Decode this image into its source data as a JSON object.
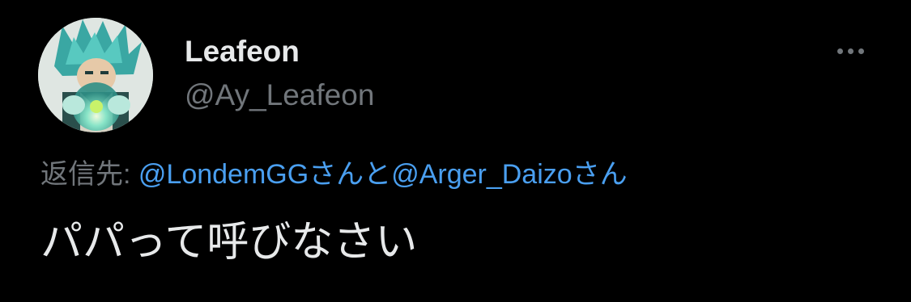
{
  "user": {
    "display_name": "Leafeon",
    "handle": "@Ay_Leafeon",
    "avatar_icon": "anime-character-avatar"
  },
  "reply": {
    "prefix": "返信先: ",
    "mentions": [
      {
        "name": "@LondemGG",
        "suffix": "さんと"
      },
      {
        "name": "@Arger_Daizo",
        "suffix": "さん"
      }
    ]
  },
  "tweet": {
    "text": "パパって呼びなさい"
  },
  "icons": {
    "more": "more-options-icon"
  },
  "colors": {
    "background": "#000000",
    "primary_text": "#e7e9ea",
    "secondary_text": "#71767b",
    "link": "#4a9ff0"
  }
}
